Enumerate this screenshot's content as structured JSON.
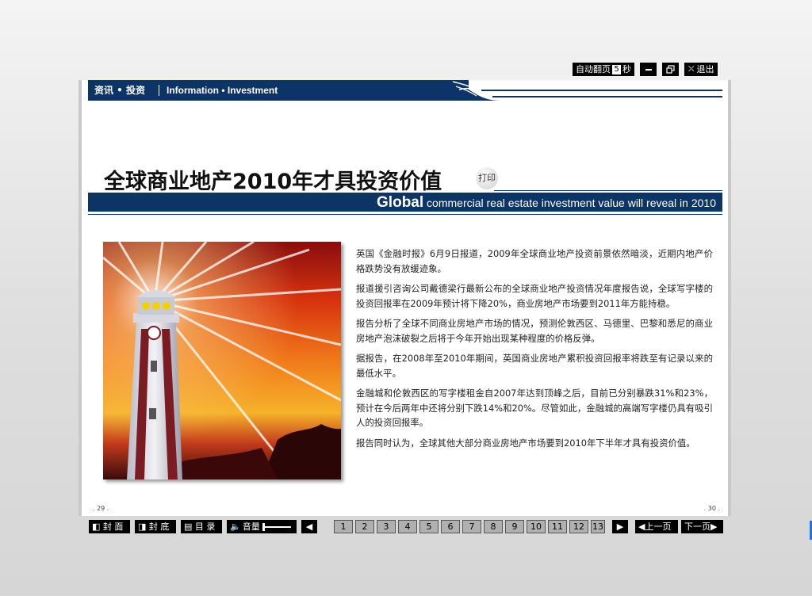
{
  "controls": {
    "autoflip_label": "自动翻页",
    "autoflip_seconds": "5",
    "seconds_unit": "秒",
    "minimize_icon": "minimize-icon",
    "restore_icon": "restore-icon",
    "exit_label": "退出"
  },
  "header": {
    "category_cn": "资讯 • 投资",
    "category_en": "Information • Investment"
  },
  "article": {
    "title": "全球商业地产2010年才具投资价值",
    "print_label": "打印",
    "banner_bold": "Global",
    "banner_rest": " commercial real estate investment value will reveal in 2010",
    "paragraphs": [
      "英国《金融时报》6月9日报道，2009年全球商业地产投资前景依然暗淡，近期内地产价格跌势没有放缓迹象。",
      "报道援引咨询公司戴德梁行最新公布的全球商业地产投资情况年度报告说，全球写字楼的投资回报率在2009年预计将下降20%，商业房地产市场要到2011年方能持稳。",
      "报告分析了全球不同商业房地产市场的情况，预测伦敦西区、马德里、巴黎和悉尼的商业房地产泡沫破裂之后将于今年开始出现某种程度的价格反弹。",
      "据报告，在2008年至2010年期间，英国商业房地产累积投资回报率将跌至有记录以来的最低水平。",
      "金融城和伦敦西区的写字楼租金自2007年达到顶峰之后，目前已分别暴跌31%和23%，预计在今后两年中还将分别下跌14%和20%。尽管如此，金融城的高端写字楼仍具有吸引人的投资回报率。",
      "报告同时认为，全球其他大部分商业房地产市场要到2010年下半年才具有投资价值。"
    ],
    "page_left": ". 29 .",
    "page_right": ". 30 ."
  },
  "toolbar": {
    "front_cover": "封 面",
    "back_cover": "封 底",
    "toc": "目 录",
    "volume": "音量",
    "pages": [
      "1",
      "2",
      "3",
      "4",
      "5",
      "6",
      "7",
      "8",
      "9",
      "10",
      "11",
      "12",
      "13"
    ],
    "prev_page": "上一页",
    "next_page": "下一页"
  },
  "colors": {
    "navy": "#0c3466",
    "toolbar_bg": "#000000",
    "page_button_bg": "#b0b0b0"
  }
}
